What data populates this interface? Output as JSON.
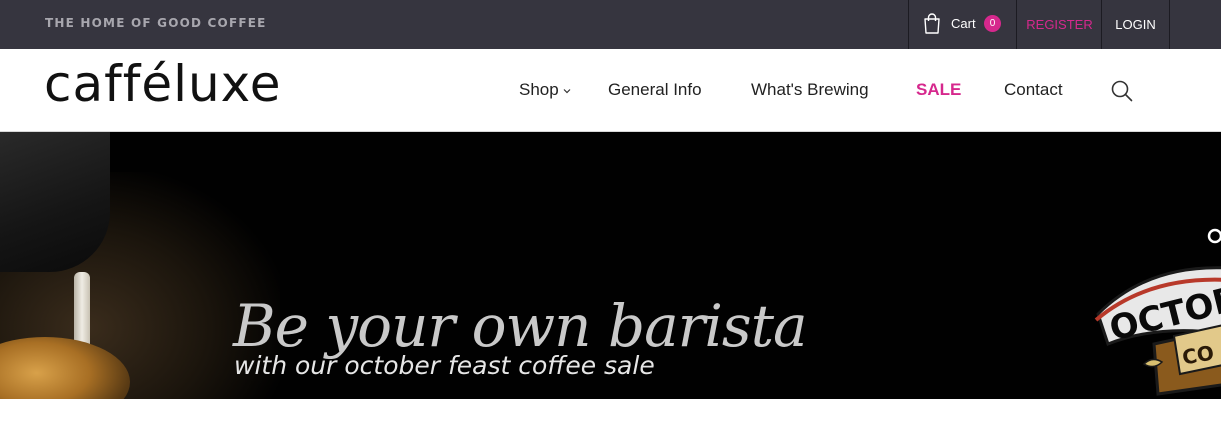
{
  "topbar": {
    "tagline": "THE HOME OF GOOD COFFEE",
    "cart_label": "Cart",
    "cart_count": "0",
    "register_label": "REGISTER",
    "login_label": "LOGIN"
  },
  "header": {
    "logo_text": "cafféluxe",
    "nav": [
      {
        "label": "Shop",
        "icon": "chevron-down-icon"
      },
      {
        "label": "General Info"
      },
      {
        "label": "What's Brewing"
      },
      {
        "label": "SALE"
      },
      {
        "label": "Contact"
      }
    ],
    "search_icon": "search-icon"
  },
  "hero": {
    "title": "Be your own barista",
    "subtitle": "with our october feast coffee sale",
    "badge_text_1": "OCTOB",
    "badge_text_2": "CO"
  },
  "colors": {
    "accent": "#d6288d",
    "topbar_bg": "#36353f",
    "hero_bg": "#010101"
  }
}
